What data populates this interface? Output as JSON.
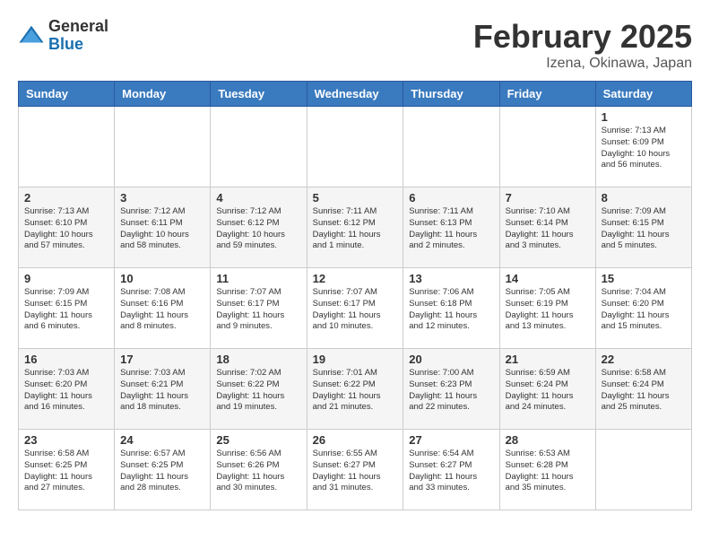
{
  "logo": {
    "general": "General",
    "blue": "Blue"
  },
  "title": "February 2025",
  "subtitle": "Izena, Okinawa, Japan",
  "days_of_week": [
    "Sunday",
    "Monday",
    "Tuesday",
    "Wednesday",
    "Thursday",
    "Friday",
    "Saturday"
  ],
  "weeks": [
    [
      {
        "day": "",
        "info": ""
      },
      {
        "day": "",
        "info": ""
      },
      {
        "day": "",
        "info": ""
      },
      {
        "day": "",
        "info": ""
      },
      {
        "day": "",
        "info": ""
      },
      {
        "day": "",
        "info": ""
      },
      {
        "day": "1",
        "info": "Sunrise: 7:13 AM\nSunset: 6:09 PM\nDaylight: 10 hours\nand 56 minutes."
      }
    ],
    [
      {
        "day": "2",
        "info": "Sunrise: 7:13 AM\nSunset: 6:10 PM\nDaylight: 10 hours\nand 57 minutes."
      },
      {
        "day": "3",
        "info": "Sunrise: 7:12 AM\nSunset: 6:11 PM\nDaylight: 10 hours\nand 58 minutes."
      },
      {
        "day": "4",
        "info": "Sunrise: 7:12 AM\nSunset: 6:12 PM\nDaylight: 10 hours\nand 59 minutes."
      },
      {
        "day": "5",
        "info": "Sunrise: 7:11 AM\nSunset: 6:12 PM\nDaylight: 11 hours\nand 1 minute."
      },
      {
        "day": "6",
        "info": "Sunrise: 7:11 AM\nSunset: 6:13 PM\nDaylight: 11 hours\nand 2 minutes."
      },
      {
        "day": "7",
        "info": "Sunrise: 7:10 AM\nSunset: 6:14 PM\nDaylight: 11 hours\nand 3 minutes."
      },
      {
        "day": "8",
        "info": "Sunrise: 7:09 AM\nSunset: 6:15 PM\nDaylight: 11 hours\nand 5 minutes."
      }
    ],
    [
      {
        "day": "9",
        "info": "Sunrise: 7:09 AM\nSunset: 6:15 PM\nDaylight: 11 hours\nand 6 minutes."
      },
      {
        "day": "10",
        "info": "Sunrise: 7:08 AM\nSunset: 6:16 PM\nDaylight: 11 hours\nand 8 minutes."
      },
      {
        "day": "11",
        "info": "Sunrise: 7:07 AM\nSunset: 6:17 PM\nDaylight: 11 hours\nand 9 minutes."
      },
      {
        "day": "12",
        "info": "Sunrise: 7:07 AM\nSunset: 6:17 PM\nDaylight: 11 hours\nand 10 minutes."
      },
      {
        "day": "13",
        "info": "Sunrise: 7:06 AM\nSunset: 6:18 PM\nDaylight: 11 hours\nand 12 minutes."
      },
      {
        "day": "14",
        "info": "Sunrise: 7:05 AM\nSunset: 6:19 PM\nDaylight: 11 hours\nand 13 minutes."
      },
      {
        "day": "15",
        "info": "Sunrise: 7:04 AM\nSunset: 6:20 PM\nDaylight: 11 hours\nand 15 minutes."
      }
    ],
    [
      {
        "day": "16",
        "info": "Sunrise: 7:03 AM\nSunset: 6:20 PM\nDaylight: 11 hours\nand 16 minutes."
      },
      {
        "day": "17",
        "info": "Sunrise: 7:03 AM\nSunset: 6:21 PM\nDaylight: 11 hours\nand 18 minutes."
      },
      {
        "day": "18",
        "info": "Sunrise: 7:02 AM\nSunset: 6:22 PM\nDaylight: 11 hours\nand 19 minutes."
      },
      {
        "day": "19",
        "info": "Sunrise: 7:01 AM\nSunset: 6:22 PM\nDaylight: 11 hours\nand 21 minutes."
      },
      {
        "day": "20",
        "info": "Sunrise: 7:00 AM\nSunset: 6:23 PM\nDaylight: 11 hours\nand 22 minutes."
      },
      {
        "day": "21",
        "info": "Sunrise: 6:59 AM\nSunset: 6:24 PM\nDaylight: 11 hours\nand 24 minutes."
      },
      {
        "day": "22",
        "info": "Sunrise: 6:58 AM\nSunset: 6:24 PM\nDaylight: 11 hours\nand 25 minutes."
      }
    ],
    [
      {
        "day": "23",
        "info": "Sunrise: 6:58 AM\nSunset: 6:25 PM\nDaylight: 11 hours\nand 27 minutes."
      },
      {
        "day": "24",
        "info": "Sunrise: 6:57 AM\nSunset: 6:25 PM\nDaylight: 11 hours\nand 28 minutes."
      },
      {
        "day": "25",
        "info": "Sunrise: 6:56 AM\nSunset: 6:26 PM\nDaylight: 11 hours\nand 30 minutes."
      },
      {
        "day": "26",
        "info": "Sunrise: 6:55 AM\nSunset: 6:27 PM\nDaylight: 11 hours\nand 31 minutes."
      },
      {
        "day": "27",
        "info": "Sunrise: 6:54 AM\nSunset: 6:27 PM\nDaylight: 11 hours\nand 33 minutes."
      },
      {
        "day": "28",
        "info": "Sunrise: 6:53 AM\nSunset: 6:28 PM\nDaylight: 11 hours\nand 35 minutes."
      },
      {
        "day": "",
        "info": ""
      }
    ]
  ]
}
